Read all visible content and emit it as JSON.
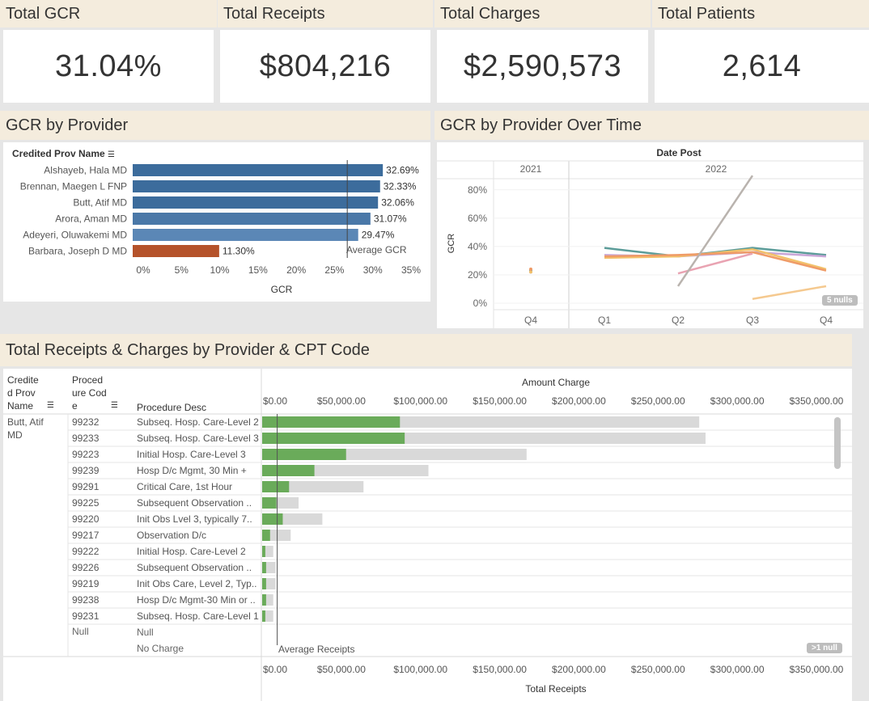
{
  "kpis": [
    {
      "title": "Total GCR",
      "value": "31.04%"
    },
    {
      "title": "Total Receipts",
      "value": "$804,216"
    },
    {
      "title": "Total Charges",
      "value": "$2,590,573"
    },
    {
      "title": "Total Patients",
      "value": "2,614"
    }
  ],
  "gcr_by_provider": {
    "title": "GCR by Provider",
    "column_header": "Credited Prov Name",
    "x_axis_title": "GCR",
    "x_ticks": [
      "0%",
      "5%",
      "10%",
      "15%",
      "20%",
      "25%",
      "30%",
      "35%"
    ],
    "reference_label": "Average GCR"
  },
  "gcr_over_time": {
    "title": "GCR by Provider Over Time",
    "column_header": "Date Post",
    "y_axis_title": "GCR",
    "years": [
      "2021",
      "2022"
    ],
    "quarters": [
      "Q4",
      "Q1",
      "Q2",
      "Q3",
      "Q4"
    ],
    "y_ticks": [
      "0%",
      "20%",
      "40%",
      "60%",
      "80%"
    ],
    "nulls_badge": "5 nulls"
  },
  "receipts_charges": {
    "title": "Total Receipts & Charges by Provider & CPT Code",
    "col_provider": "Credite d Prov Name",
    "col_code": "Proced ure Cod e",
    "col_desc": "Procedure Desc",
    "provider": "Butt, Atif MD",
    "top_axis_title": "Amount Charge",
    "bottom_axis_title": "Total Receipts",
    "x_ticks": [
      "$0.00",
      "$50,000.00",
      "$100,000.00",
      "$150,000.00",
      "$200,000.00",
      "$250,000.00",
      "$300,000.00",
      "$350,000.00"
    ],
    "reference_label": "Average Receipts",
    "null_badge": ">1 null",
    "null_code": "Null",
    "null_desc": "Null",
    "no_charge": "No Charge"
  },
  "chart_data": [
    {
      "type": "bar",
      "orientation": "horizontal",
      "title": "GCR by Provider",
      "xlabel": "GCR",
      "xlim": [
        0,
        0.35
      ],
      "categories": [
        "Alshayeb, Hala MD",
        "Brennan, Maegen L FNP",
        "Butt, Atif MD",
        "Arora, Aman MD",
        "Adeyeri, Oluwakemi MD",
        "Barbara, Joseph D MD"
      ],
      "values": [
        0.3269,
        0.3233,
        0.3206,
        0.3107,
        0.2947,
        0.113
      ],
      "labels": [
        "32.69%",
        "32.33%",
        "32.06%",
        "31.07%",
        "29.47%",
        "11.30%"
      ],
      "colors": [
        "#3c6c9c",
        "#3c6c9c",
        "#3c6c9c",
        "#4a78a8",
        "#5b87b6",
        "#b5522a"
      ],
      "reference_line": {
        "label": "Average GCR",
        "value": 0.2804
      }
    },
    {
      "type": "line",
      "title": "GCR by Provider Over Time",
      "ylabel": "GCR",
      "ylim": [
        0,
        0.85
      ],
      "x": [
        "2021 Q4",
        "2022 Q1",
        "2022 Q2",
        "2022 Q3",
        "2022 Q4"
      ],
      "series": [
        {
          "color": "#5b9c99",
          "values": [
            0.23,
            0.39,
            0.33,
            0.39,
            0.34
          ]
        },
        {
          "color": "#c9a6d7",
          "values": [
            0.22,
            0.34,
            0.33,
            0.36,
            0.33
          ]
        },
        {
          "color": "#f2c26b",
          "values": [
            0.22,
            0.32,
            0.33,
            0.38,
            0.24
          ]
        },
        {
          "color": "#ef9b67",
          "values": [
            0.24,
            0.33,
            0.34,
            0.36,
            0.23
          ]
        },
        {
          "color": "#e9a3b2",
          "values": [
            null,
            null,
            0.21,
            0.35,
            null
          ]
        },
        {
          "color": "#b9b3ae",
          "values": [
            null,
            null,
            0.12,
            0.9,
            null
          ]
        },
        {
          "color": "#f5c98f",
          "values": [
            null,
            null,
            null,
            0.03,
            0.12
          ]
        }
      ]
    },
    {
      "type": "bar",
      "orientation": "horizontal",
      "title": "Total Receipts & Charges by Provider & CPT Code",
      "xlabel": "Total Receipts",
      "x2label": "Amount Charge",
      "xlim": [
        0,
        350000
      ],
      "categories": [
        "99232",
        "99233",
        "99223",
        "99239",
        "99291",
        "99225",
        "99220",
        "99217",
        "99222",
        "99226",
        "99219",
        "99238",
        "99231"
      ],
      "descriptions": [
        "Subseq. Hosp. Care-Level 2",
        "Subseq. Hosp. Care-Level 3",
        "Initial Hosp. Care-Level 3",
        "Hosp D/c Mgmt, 30 Min +",
        "Critical Care, 1st Hour",
        "Subsequent Observation ..",
        "Init Obs Lvel 3, typically 7..",
        "Observation D/c",
        "Initial Hosp. Care-Level 2",
        "Subsequent Observation ..",
        "Init Obs Care, Level 2, Typ..",
        "Hosp D/c Mgmt-30 Min or ..",
        "Subseq. Hosp. Care-Level 1"
      ],
      "series": [
        {
          "name": "Total Receipts",
          "color": "#6aab5a",
          "values": [
            87000,
            90000,
            53000,
            33000,
            17000,
            9000,
            13000,
            5000,
            2000,
            2500,
            2500,
            2500,
            2000
          ]
        },
        {
          "name": "Amount Charge",
          "color": "#d9d9d9",
          "values": [
            276000,
            280000,
            167000,
            105000,
            64000,
            23000,
            38000,
            18000,
            7000,
            8500,
            8500,
            7000,
            7000
          ]
        }
      ],
      "reference_line": {
        "label": "Average Receipts",
        "value": 9500
      }
    }
  ]
}
